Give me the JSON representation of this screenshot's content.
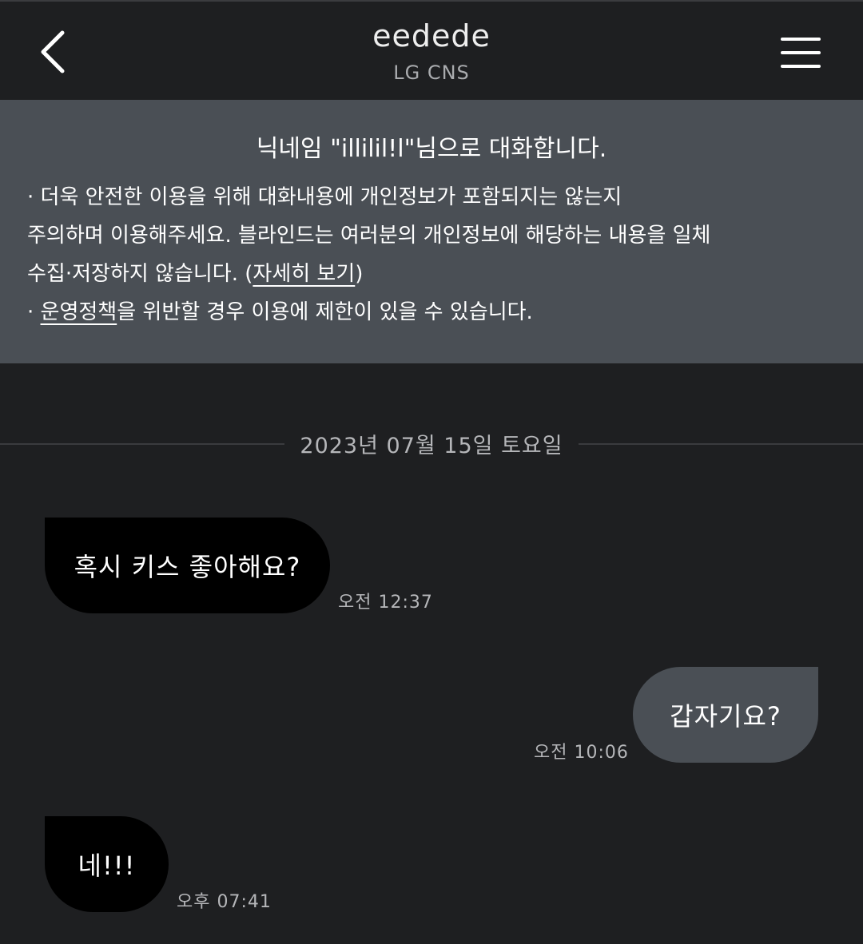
{
  "header": {
    "title": "eedede",
    "subtitle": "LG CNS",
    "back_icon": "chevron-left-icon",
    "menu_icon": "hamburger-menu-icon"
  },
  "notice": {
    "title": "닉네임 \"illilil!l\"님으로 대화합니다.",
    "line1": "· 더욱 안전한 이용을 위해 대화내용에 개인정보가 포함되지는 않는지",
    "line2": "주의하며 이용해주세요. 블라인드는 여러분의 개인정보에 해당하는 내용을 일체",
    "line3_prefix": "수집·저장하지 않습니다. (",
    "details_link": "자세히 보기",
    "line3_suffix": ")",
    "line4_prefix": "· ",
    "policy_link": "운영정책",
    "line4_suffix": "을 위반할 경우 이용에 제한이 있을 수 있습니다."
  },
  "date_divider": "2023년 07월 15일 토요일",
  "messages": [
    {
      "direction": "in",
      "text": "혹시 키스 좋아해요?",
      "time": "오전 12:37"
    },
    {
      "direction": "out",
      "text": "갑자기요?",
      "time": "오전 10:06"
    },
    {
      "direction": "in",
      "text": "네!!!",
      "time": "오후 07:41"
    }
  ],
  "colors": {
    "background": "#1e1f21",
    "notice_bg": "#4a4f55",
    "incoming_bubble": "#000000",
    "outgoing_bubble": "#4a4f55"
  }
}
